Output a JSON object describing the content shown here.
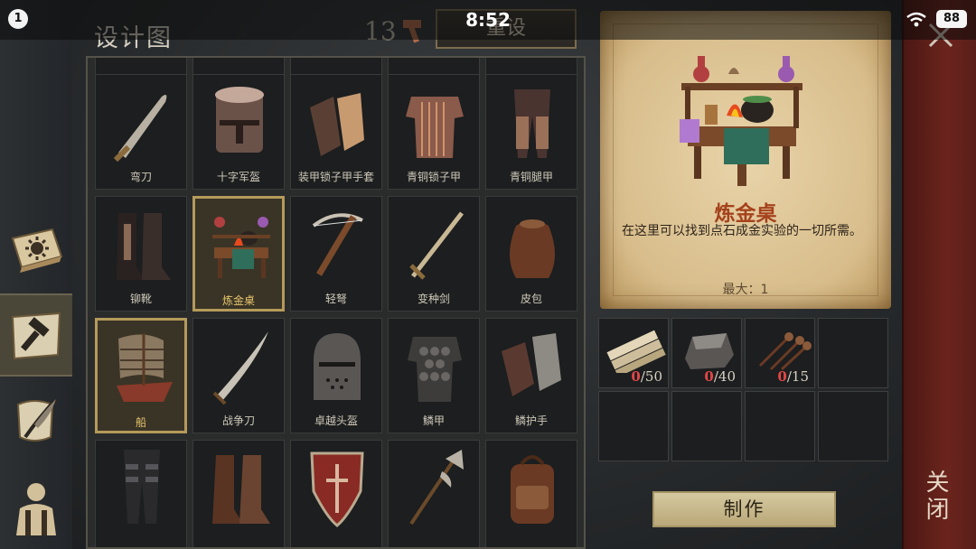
{
  "status_bar": {
    "notification_count": "1",
    "time": "8:52",
    "battery": "88"
  },
  "header": {
    "title": "设计图",
    "resource_count": "13",
    "reset_label": "重设"
  },
  "left_rail": {
    "tabs": [
      {
        "icon": "sun-book-icon",
        "active": false
      },
      {
        "icon": "hammer-map-icon",
        "active": true
      },
      {
        "icon": "scroll-quill-icon",
        "active": false
      },
      {
        "icon": "character-backpack-icon",
        "active": false
      }
    ]
  },
  "blueprints": {
    "rows": [
      [
        {
          "label": "",
          "icon": "partial-item"
        },
        {
          "label": "",
          "icon": "partial-item"
        },
        {
          "label": "",
          "icon": "partial-item"
        },
        {
          "label": "",
          "icon": "partial-item"
        },
        {
          "label": "",
          "icon": "partial-item"
        }
      ],
      [
        {
          "label": "弯刀",
          "icon": "scimitar-icon"
        },
        {
          "label": "十字军盔",
          "icon": "crusader-helmet-icon"
        },
        {
          "label": "装甲锁子甲手套",
          "icon": "chainmail-gloves-icon"
        },
        {
          "label": "青铜锁子甲",
          "icon": "bronze-chainmail-icon"
        },
        {
          "label": "青铜腿甲",
          "icon": "bronze-greaves-icon"
        }
      ],
      [
        {
          "label": "铆靴",
          "icon": "riveted-boots-icon"
        },
        {
          "label": "炼金桌",
          "icon": "alchemy-table-icon",
          "selected": true
        },
        {
          "label": "轻弩",
          "icon": "light-crossbow-icon"
        },
        {
          "label": "变种剑",
          "icon": "mutant-sword-icon"
        },
        {
          "label": "皮包",
          "icon": "leather-bag-icon"
        }
      ],
      [
        {
          "label": "船",
          "icon": "ship-icon",
          "highlight": true
        },
        {
          "label": "战争刀",
          "icon": "war-blade-icon"
        },
        {
          "label": "卓越头盔",
          "icon": "superior-helmet-icon"
        },
        {
          "label": "鳞甲",
          "icon": "scale-armor-icon"
        },
        {
          "label": "鳞护手",
          "icon": "scale-gauntlets-icon"
        }
      ],
      [
        {
          "label": "",
          "icon": "plate-leggings-icon"
        },
        {
          "label": "",
          "icon": "leather-boots-icon"
        },
        {
          "label": "",
          "icon": "shield-icon"
        },
        {
          "label": "",
          "icon": "halberd-icon"
        },
        {
          "label": "",
          "icon": "backpack-icon"
        }
      ]
    ]
  },
  "detail": {
    "title": "炼金桌",
    "description": "在这里可以找到点石成金实验的一切所需。",
    "max_label": "最大：1"
  },
  "materials": [
    {
      "icon": "planks-icon",
      "have": "0",
      "need": "/50"
    },
    {
      "icon": "iron-ingot-icon",
      "have": "0",
      "need": "/40"
    },
    {
      "icon": "nails-icon",
      "have": "0",
      "need": "/15"
    }
  ],
  "craft_label": "制作",
  "close_label": "关闭",
  "colors": {
    "accent_gold": "#b59a5a",
    "title_red": "#a5421c",
    "missing_red": "#e14747",
    "close_strip": "#6b241d"
  }
}
